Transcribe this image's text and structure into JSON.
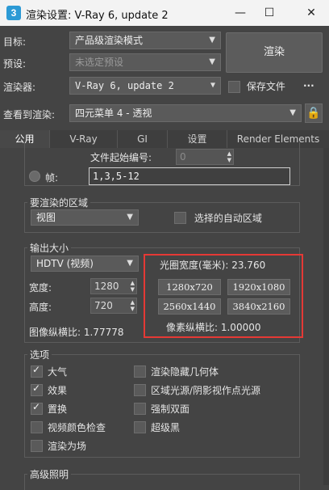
{
  "window": {
    "app_icon_glyph": "3",
    "title": "渲染设置: V-Ray 6, update 2",
    "minimize_glyph": "—",
    "maximize_glyph": "☐",
    "close_glyph": "✕"
  },
  "top": {
    "target_label": "目标:",
    "target_value": "产品级渲染模式",
    "preset_label": "预设:",
    "preset_value": "未选定预设",
    "renderer_label": "渲染器:",
    "renderer_value": "V-Ray 6, update 2",
    "save_file_label": "保存文件",
    "more_glyph": "...",
    "view_label": "查看到渲染:",
    "view_value": "四元菜单 4 - 透视",
    "render_button": "渲染",
    "lock_icon": "lock-icon"
  },
  "tabs": [
    "公用",
    "V-Ray",
    "GI",
    "设置",
    "Render Elements"
  ],
  "frames": {
    "file_start_label": "文件起始编号:",
    "file_start_value": "0",
    "frames_label": "帧:",
    "frames_value": "1,3,5-12"
  },
  "area": {
    "title": "要渲染的区域",
    "mode": "视图",
    "auto_region_label": "选择的自动区域"
  },
  "output_size": {
    "title": "输出大小",
    "preset": "HDTV (视频)",
    "width_label": "宽度:",
    "width_value": "1280",
    "height_label": "高度:",
    "height_value": "720",
    "aperture_label": "光圈宽度(毫米): 23.760",
    "presets": [
      "1280x720",
      "1920x1080",
      "2560x1440",
      "3840x2160"
    ],
    "image_aspect_label": "图像纵横比: 1.77778",
    "pixel_aspect_label": "像素纵横比: 1.00000",
    "highlight_color": "#e53935"
  },
  "options": {
    "title": "选项",
    "items": [
      {
        "label": "大气",
        "checked": true
      },
      {
        "label": "渲染隐藏几何体",
        "checked": false
      },
      {
        "label": "效果",
        "checked": true
      },
      {
        "label": "区域光源/阴影视作点光源",
        "checked": false
      },
      {
        "label": "置换",
        "checked": true
      },
      {
        "label": "强制双面",
        "checked": false
      },
      {
        "label": "视频颜色检查",
        "checked": false
      },
      {
        "label": "超级黑",
        "checked": false
      },
      {
        "label": "渲染为场",
        "checked": false
      }
    ]
  },
  "advanced_lighting": {
    "title": "高级照明"
  }
}
